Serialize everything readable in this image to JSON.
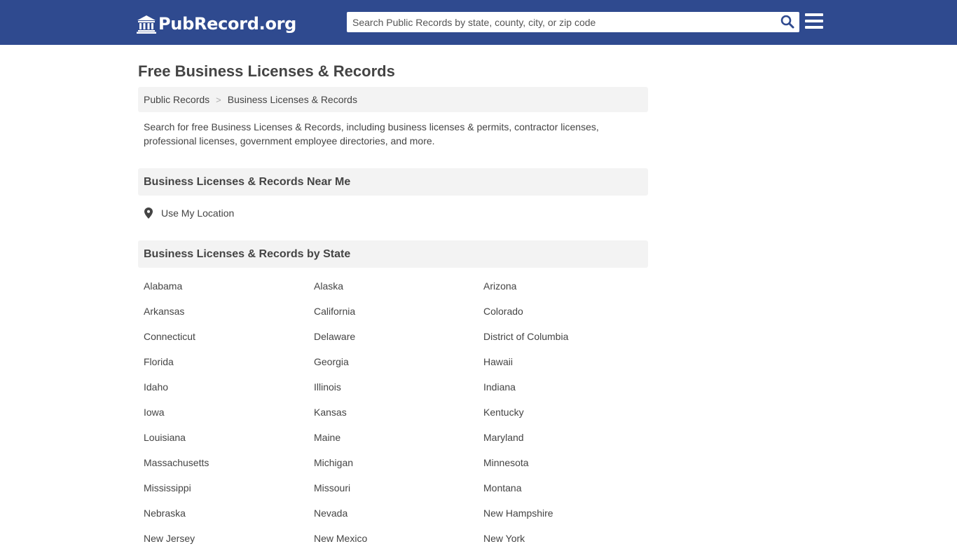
{
  "header": {
    "logo_text": "PubRecord.org",
    "logo_icon": "courthouse-icon",
    "search_placeholder": "Search Public Records by state, county, city, or zip code",
    "search_icon": "search-icon",
    "menu_icon": "hamburger-menu-icon",
    "bar_color": "#2f4a8f"
  },
  "page": {
    "title": "Free Business Licenses & Records",
    "breadcrumb": [
      {
        "label": "Public Records"
      },
      {
        "label": "Business Licenses & Records"
      }
    ],
    "breadcrumb_separator": ">",
    "intro": "Search for free Business Licenses & Records, including business licenses & permits, contractor licenses, professional licenses, government employee directories, and more."
  },
  "near_me": {
    "heading": "Business Licenses & Records Near Me",
    "location_label": "Use My Location",
    "location_icon": "map-pin-icon"
  },
  "by_state": {
    "heading": "Business Licenses & Records by State",
    "states": [
      "Alabama",
      "Alaska",
      "Arizona",
      "Arkansas",
      "California",
      "Colorado",
      "Connecticut",
      "Delaware",
      "District of Columbia",
      "Florida",
      "Georgia",
      "Hawaii",
      "Idaho",
      "Illinois",
      "Indiana",
      "Iowa",
      "Kansas",
      "Kentucky",
      "Louisiana",
      "Maine",
      "Maryland",
      "Massachusetts",
      "Michigan",
      "Minnesota",
      "Mississippi",
      "Missouri",
      "Montana",
      "Nebraska",
      "Nevada",
      "New Hampshire",
      "New Jersey",
      "New Mexico",
      "New York"
    ]
  }
}
